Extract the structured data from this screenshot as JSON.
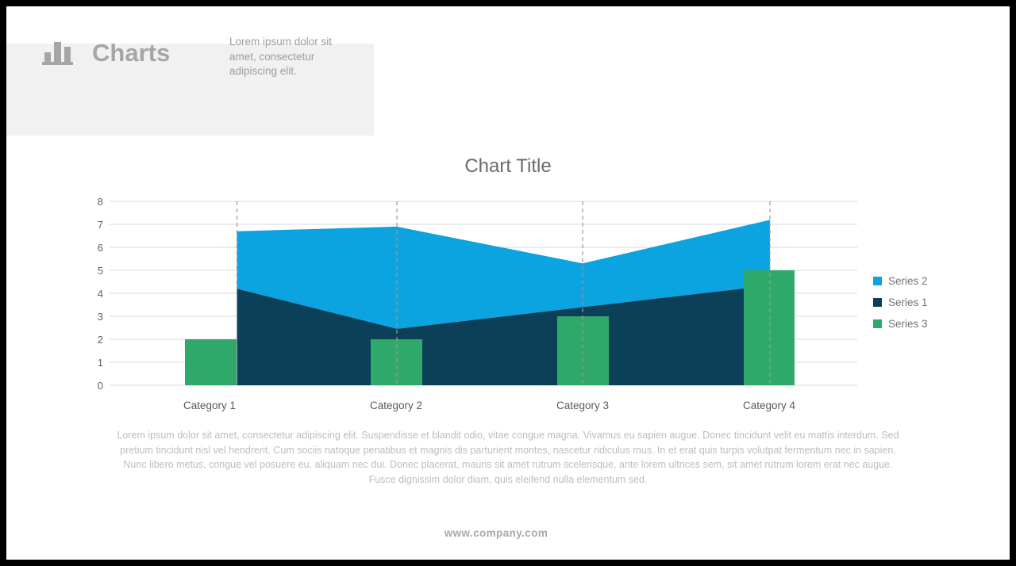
{
  "header": {
    "icon": "bar-chart-icon",
    "title": "Charts",
    "subtitle": "Lorem ipsum dolor sit amet, consectetur adipiscing elit."
  },
  "body_text": "Lorem ipsum dolor sit amet, consectetur adipiscing elit. Suspendisse et blandit odio, vitae congue magna. Vivamus eu sapien augue. Donec tincidunt velit eu mattis interdum. Sed pretium tincidunt nisl vel hendrerit. Cum sociis natoque penatibus et magnis dis parturient montes, nascetur ridiculus mus. In et erat quis turpis volutpat fermentum nec in sapien. Nunc libero metus, congue vel posuere eu, aliquam nec dui. Donec placerat, mauris sit amet rutrum scelerisque, ante lorem ultrices sem, sit amet rutrum lorem erat nec augue. Fusce dignissim dolor diam, quis eleifend nulla elementum sed.",
  "footer": {
    "url": "www.company.com"
  },
  "legend": {
    "items": [
      {
        "label": "Series 2",
        "color": "#0BA3E0"
      },
      {
        "label": "Series 1",
        "color": "#0C3F58"
      },
      {
        "label": "Series 3",
        "color": "#2FA96A"
      }
    ]
  },
  "chart_data": {
    "type": "area",
    "title": "Chart Title",
    "xlabel": "",
    "ylabel": "",
    "ylim": [
      0,
      8
    ],
    "yticks": [
      0,
      1,
      2,
      3,
      4,
      5,
      6,
      7,
      8
    ],
    "ytick_labels": [
      "0",
      "1",
      "2",
      "3",
      "4",
      "5",
      "6",
      "7",
      "8"
    ],
    "categories": [
      "Category 1",
      "Category 2",
      "Category 3",
      "Category 4"
    ],
    "grid": "horizontal-solid-and-vertical-dashed",
    "legend_position": "right",
    "series": [
      {
        "name": "Series 1",
        "type": "area",
        "stacked": true,
        "color": "#0C3F58",
        "values": [
          4.2,
          2.45,
          3.4,
          4.35
        ]
      },
      {
        "name": "Series 2",
        "type": "area",
        "stacked": true,
        "color": "#0BA3E0",
        "values": [
          2.5,
          4.45,
          1.9,
          2.85
        ],
        "cumulative_top": [
          6.7,
          6.9,
          5.3,
          7.2
        ]
      },
      {
        "name": "Series 3",
        "type": "bar",
        "color": "#2FA96A",
        "values": [
          2,
          2,
          3,
          5
        ]
      }
    ]
  }
}
